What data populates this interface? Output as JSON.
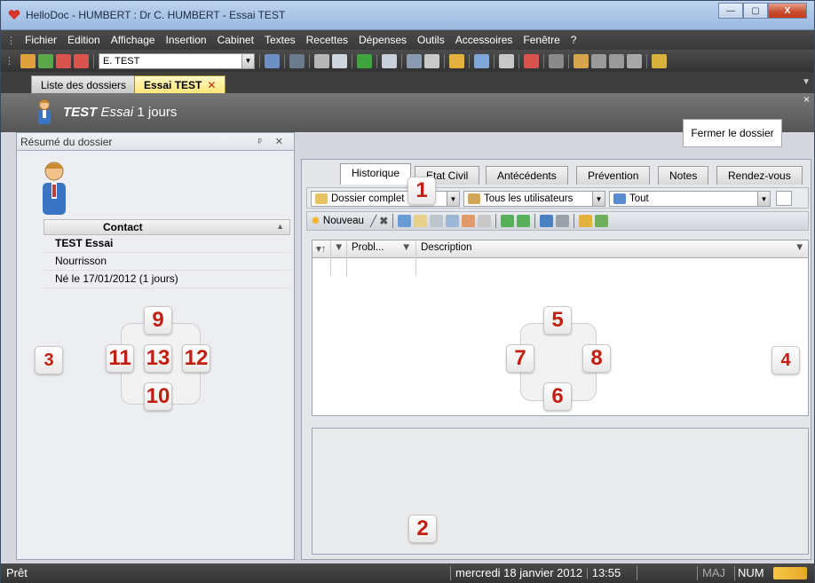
{
  "window": {
    "title": "HelloDoc - HUMBERT : Dr C. HUMBERT - Essai TEST",
    "buttons": {
      "minimize": "—",
      "maximize": "▢",
      "close": "X"
    }
  },
  "menu": [
    "Fichier",
    "Edition",
    "Affichage",
    "Insertion",
    "Cabinet",
    "Textes",
    "Recettes",
    "Dépenses",
    "Outils",
    "Accessoires",
    "Fenêtre",
    "?"
  ],
  "toolbar": {
    "patient_combo_value": "E. TEST"
  },
  "doc_tabs": [
    {
      "label": "Liste des dossiers"
    },
    {
      "label": "Essai TEST",
      "close": "✕"
    }
  ],
  "header": {
    "last_name": "TEST",
    "first_name": "Essai",
    "age": "1 jours",
    "close_button": "Fermer le dossier",
    "close_x": "×"
  },
  "left_pane": {
    "title": "Résumé du dossier",
    "title_buttons": "ᵖ ✕",
    "contact_header": "Contact",
    "contact_lines": [
      "TEST Essai",
      "Nourrisson",
      "Né le 17/01/2012 (1 jours)"
    ]
  },
  "right_tabs": [
    "Historique",
    "Etat Civil",
    "Antécédents",
    "Prévention",
    "Notes",
    "Rendez-vous"
  ],
  "filters": {
    "dossier": "Dossier complet",
    "users": "Tous les utilisateurs",
    "type": "Tout"
  },
  "actions": {
    "new_label": "Nouveau"
  },
  "grid": {
    "columns": [
      "Probl...",
      "Description"
    ]
  },
  "markers": {
    "m1": "1",
    "m2": "2",
    "m3": "3",
    "m4": "4",
    "m5": "5",
    "m6": "6",
    "m7": "7",
    "m8": "8",
    "m9": "9",
    "m10": "10",
    "m11": "11",
    "m12": "12",
    "m13": "13"
  },
  "status": {
    "state": "Prêt",
    "date": "mercredi 18 janvier 2012",
    "time": "13:55",
    "maj": "MAJ",
    "num": "NUM"
  },
  "colors": {
    "marker_number": "#c21f12",
    "active_doc_tab": "#ffe67a",
    "header_bg": "#5e5e5e"
  }
}
